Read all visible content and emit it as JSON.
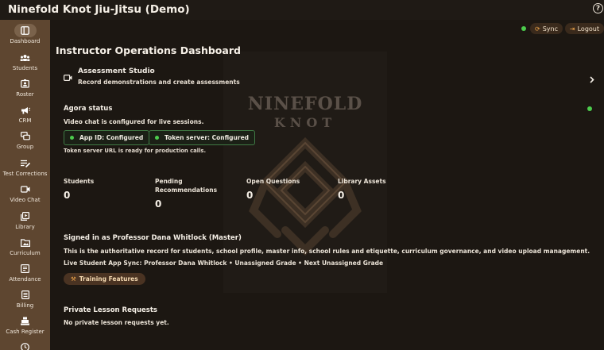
{
  "app": {
    "title": "Ninefold Knot Jiu-Jitsu (Demo)"
  },
  "sidebar": {
    "items": [
      {
        "label": "Dashboard",
        "icon": "dashboard-icon",
        "active": true
      },
      {
        "label": "Students",
        "icon": "students-icon"
      },
      {
        "label": "Roster",
        "icon": "roster-icon"
      },
      {
        "label": "CRM",
        "icon": "megaphone-icon"
      },
      {
        "label": "Group",
        "icon": "group-icon"
      },
      {
        "label": "Test Corrections",
        "icon": "list-edit-icon"
      },
      {
        "label": "Video Chat",
        "icon": "video-icon"
      },
      {
        "label": "Library",
        "icon": "library-icon"
      },
      {
        "label": "Curriculum",
        "icon": "curriculum-icon"
      },
      {
        "label": "Attendance",
        "icon": "attendance-icon"
      },
      {
        "label": "Billing",
        "icon": "billing-icon"
      },
      {
        "label": "Cash Register",
        "icon": "cash-register-icon"
      },
      {
        "label": "",
        "icon": "clock-icon"
      }
    ]
  },
  "header": {
    "sync_label": "Sync",
    "logout_label": "Logout"
  },
  "watermark": {
    "line1": "NINEFOLD",
    "line2": "KNOT"
  },
  "main": {
    "title": "Instructor Operations Dashboard",
    "studio": {
      "title": "Assessment Studio",
      "subtitle": "Record demonstrations and create assessments"
    },
    "agora": {
      "title": "Agora status",
      "description": "Video chat is configured for live sessions.",
      "badges": [
        "App ID: Configured",
        "Token server: Configured"
      ],
      "note": "Token server URL is ready for production calls."
    },
    "stats": [
      {
        "label": "Students",
        "value": "0"
      },
      {
        "label": "Pending Recommendations",
        "value": "0"
      },
      {
        "label": "Open Questions",
        "value": "0"
      },
      {
        "label": "Library Assets",
        "value": "0"
      }
    ],
    "signed_in": {
      "title": "Signed in as Professor Dana Whitlock (Master)",
      "description": "This is the authoritative record for students, school profile, master info, school rules and etiquette, curriculum governance, and video upload management.",
      "sync": "Live Student App Sync: Professor Dana Whitlock • Unassigned Grade • Next Unassigned Grade",
      "button_label": "Training Features"
    },
    "private_lessons": {
      "title": "Private Lesson Requests",
      "empty_text": "No private lesson requests yet."
    }
  },
  "colors": {
    "background": "#1c1712",
    "sidebar": "#5e4630",
    "accent": "#f0a64a",
    "status_green": "#4ccb4c"
  }
}
